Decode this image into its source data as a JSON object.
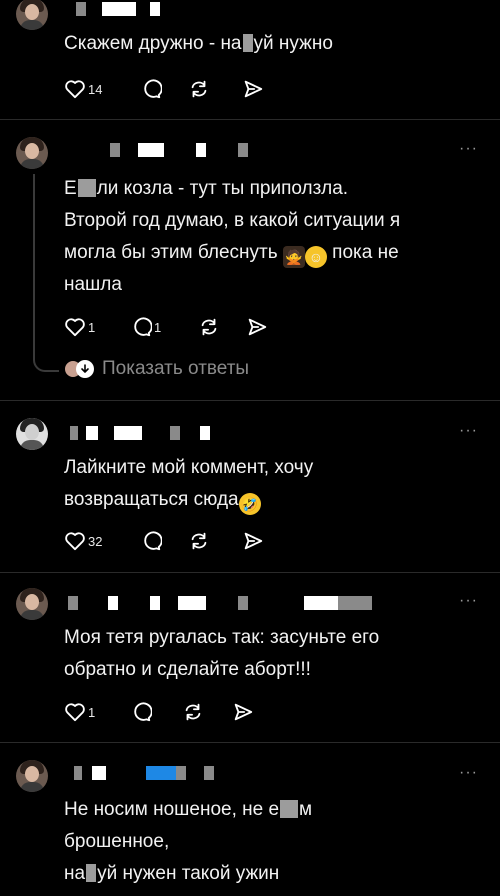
{
  "posts": [
    {
      "text_parts": [
        "Скажем дружно - на",
        "уй нужно"
      ],
      "likes": "14"
    },
    {
      "lines": [
        [
          "Е",
          "ли козла - тут ты приползла."
        ],
        [
          "Второй год думаю, в какой ситуации я"
        ],
        [
          "могла бы этим блеснуть",
          " пока не"
        ],
        [
          "нашла"
        ]
      ],
      "likes": "1",
      "replies": "1",
      "show_replies": "Показать ответы",
      "more": "···"
    },
    {
      "lines": [
        "Лайкните мой коммент, хочу",
        "возвращаться сюда"
      ],
      "likes": "32",
      "more": "···"
    },
    {
      "lines": [
        "Моя тетя ругалась так: засуньте его",
        "обратно и сделайте аборт!!!"
      ],
      "likes": "1",
      "more": "···"
    },
    {
      "lines": [
        [
          "Не носим ношеное, не е",
          "м"
        ],
        [
          "брошенное,"
        ],
        [
          "на",
          "уй нужен такой ужин"
        ]
      ],
      "more": "···"
    }
  ],
  "icons": [
    "heart-icon",
    "comment-icon",
    "repost-icon",
    "share-icon",
    "more-icon",
    "arrow-down-icon"
  ],
  "colors": {
    "background": "#000000",
    "text": "#f2f2f2",
    "muted": "#8a8a8a",
    "accent_blue": "#1e88e5"
  }
}
